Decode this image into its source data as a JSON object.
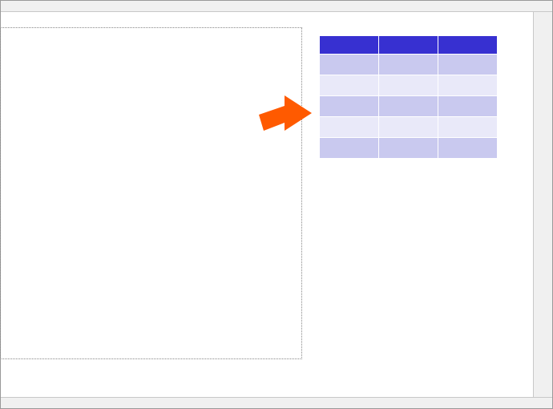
{
  "annotation": {
    "arrow_color": "#ff5a00"
  },
  "table": {
    "columns": 3,
    "header_color": "#3730d1",
    "row_odd_color": "#c9c9ef",
    "row_even_color": "#e9e9f9",
    "rows": [
      {
        "kind": "hdr",
        "cells": [
          "",
          "",
          ""
        ]
      },
      {
        "kind": "odd",
        "cells": [
          "",
          "",
          ""
        ]
      },
      {
        "kind": "even",
        "cells": [
          "",
          "",
          ""
        ]
      },
      {
        "kind": "odd",
        "cells": [
          "",
          "",
          ""
        ]
      },
      {
        "kind": "even",
        "cells": [
          "",
          "",
          ""
        ]
      },
      {
        "kind": "odd",
        "cells": [
          "",
          "",
          ""
        ]
      }
    ]
  }
}
